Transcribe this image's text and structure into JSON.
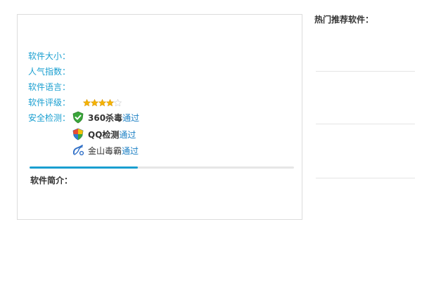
{
  "software_info": {
    "size_label": "软件大小：",
    "popularity_label": "人气指数：",
    "language_label": "软件语言：",
    "rating_label": "软件评级：",
    "rating": {
      "filled": 4,
      "total": 5
    },
    "security_label": "安全检测：",
    "scans": [
      {
        "name": "360杀毒",
        "status": "通过",
        "icon": "green-shield-check-icon"
      },
      {
        "name": "QQ检测",
        "status": "通过",
        "icon": "qq-shield-icon"
      },
      {
        "name": "金山毒霸",
        "status": "通过",
        "icon": "kingsoft-icon"
      }
    ],
    "download_progress": 0.41,
    "intro_label": "软件简介："
  },
  "sidebar": {
    "title": "热门推荐软件："
  },
  "colors": {
    "label": "#1a9fd0",
    "status": "#1a7fc4",
    "progress": "#1a9fd0",
    "star": "#f5b400"
  }
}
